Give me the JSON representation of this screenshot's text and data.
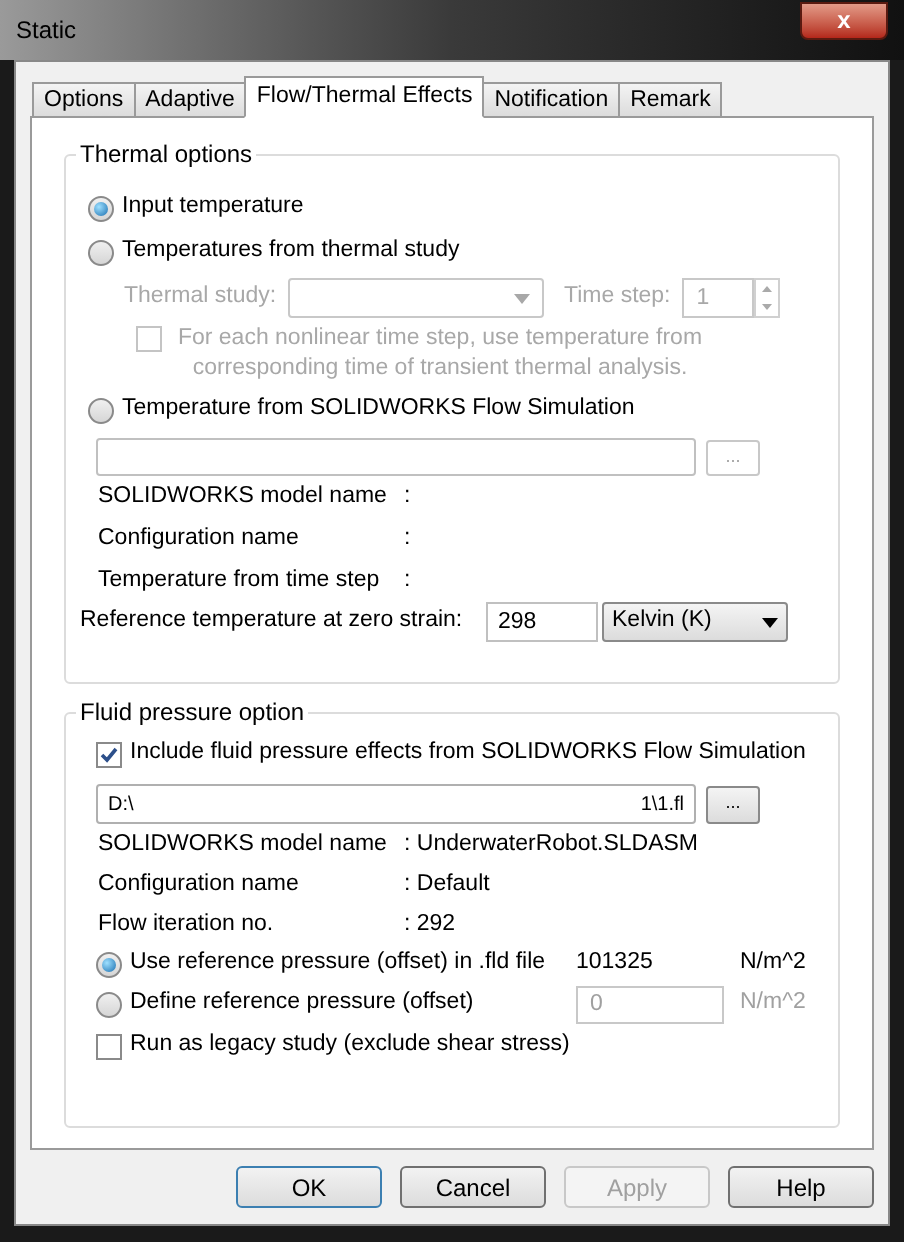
{
  "window": {
    "title": "Static",
    "close": "x"
  },
  "tabs": [
    {
      "label": "Options",
      "selected": false
    },
    {
      "label": "Adaptive",
      "selected": false
    },
    {
      "label": "Flow/Thermal Effects",
      "selected": true
    },
    {
      "label": "Notification",
      "selected": false
    },
    {
      "label": "Remark",
      "selected": false
    }
  ],
  "thermal_options": {
    "title": "Thermal options",
    "sources": [
      {
        "kind": "plain",
        "label": "Input temperature",
        "selected": true
      },
      {
        "kind": "study",
        "label": "Temperatures from thermal study",
        "selected": false,
        "study_label": "Thermal study:",
        "time_step_label": "Time step:",
        "time_step": "1",
        "nonlinear": {
          "label": "For each nonlinear time step, use temperature from corresponding time of transient thermal analysis.",
          "checked": false
        }
      },
      {
        "kind": "flow",
        "label": "Temperature from SOLIDWORKS Flow Simulation",
        "selected": false,
        "browse": "...",
        "info": [
          {
            "label": "SOLIDWORKS model name",
            "value": ":"
          },
          {
            "label": "Configuration name",
            "value": ":"
          },
          {
            "label": "Temperature from time step",
            "value": ":"
          }
        ]
      }
    ],
    "reference": {
      "label": "Reference temperature at zero strain:",
      "value": "298",
      "unit": "Kelvin (K)"
    }
  },
  "fluid_pressure": {
    "title": "Fluid pressure option",
    "include": {
      "label": "Include fluid pressure effects from SOLIDWORKS Flow Simulation",
      "checked": true
    },
    "path": {
      "start": "D:\\",
      "end": "1\\1.fl"
    },
    "browse": "...",
    "info": [
      {
        "label": "SOLIDWORKS model name",
        "value": ": UnderwaterRobot.SLDASM"
      },
      {
        "label": "Configuration name",
        "value": ": Default"
      },
      {
        "label": "Flow iteration no.",
        "value": ": 292"
      }
    ],
    "pressure": [
      {
        "kind": "text",
        "label": "Use reference pressure (offset) in .fld file",
        "selected": true,
        "value": "101325",
        "unit": "N/m^2"
      },
      {
        "kind": "field",
        "label": "Define reference pressure (offset)",
        "selected": false,
        "value": "0",
        "unit": "N/m^2"
      }
    ],
    "legacy": {
      "label": "Run as legacy study (exclude shear stress)",
      "checked": false
    }
  },
  "buttons": [
    {
      "label": "OK",
      "default": true,
      "disabled": false
    },
    {
      "label": "Cancel",
      "default": false,
      "disabled": false
    },
    {
      "label": "Apply",
      "default": false,
      "disabled": true
    },
    {
      "label": "Help",
      "default": false,
      "disabled": false
    }
  ]
}
